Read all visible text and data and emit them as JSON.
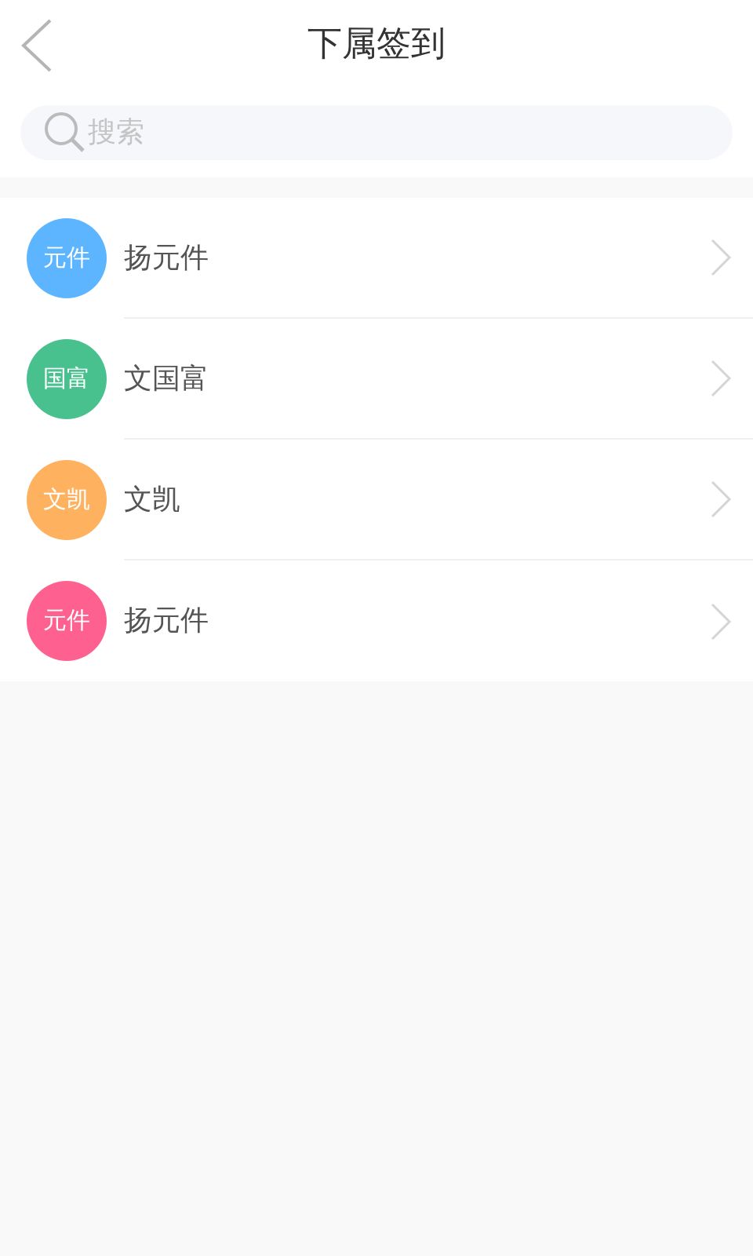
{
  "header": {
    "title": "下属签到"
  },
  "search": {
    "placeholder": "搜索"
  },
  "people": [
    {
      "avatar_text": "元件",
      "name": "扬元件",
      "color": "#5cb5fe"
    },
    {
      "avatar_text": "国富",
      "name": "文国富",
      "color": "#49c18f"
    },
    {
      "avatar_text": "文凯",
      "name": "文凯",
      "color": "#feb25f"
    },
    {
      "avatar_text": "元件",
      "name": "扬元件",
      "color": "#fe6190"
    }
  ]
}
